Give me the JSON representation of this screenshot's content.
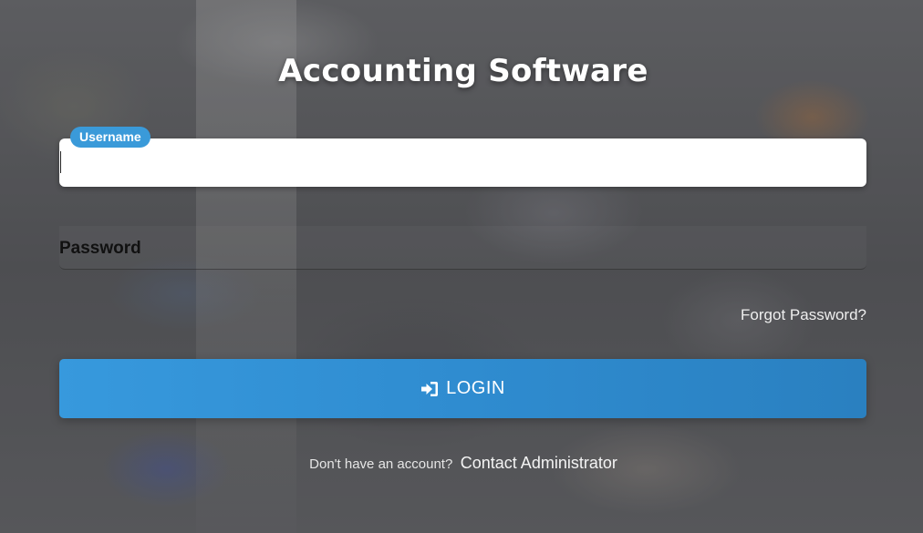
{
  "app": {
    "title": "Accounting Software"
  },
  "form": {
    "username": {
      "label": "Username",
      "value": ""
    },
    "password": {
      "label": "Password",
      "value": ""
    },
    "forgot_link": "Forgot Password?",
    "login_button": {
      "label": "LOGIN",
      "icon": "sign-in-icon"
    }
  },
  "footer": {
    "question": "Don't have an account?",
    "link": "Contact Administrator"
  },
  "colors": {
    "accent": "#3799dd",
    "badge": "#3a9ad9",
    "title": "#ffffff"
  }
}
